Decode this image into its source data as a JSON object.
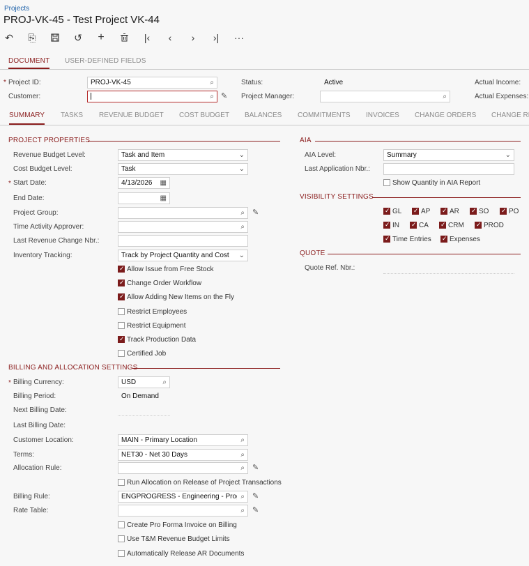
{
  "breadcrumb": "Projects",
  "title": "PROJ-VK-45 - Test Project VK-44",
  "toolbar": {
    "back": "↶",
    "save_close": "⎘",
    "save": "🖫",
    "undo": "↺",
    "add": "+",
    "delete": "🗑",
    "first": "|‹",
    "prev": "‹",
    "next": "›",
    "last": "›|",
    "more": "···"
  },
  "top_tabs": [
    "DOCUMENT",
    "USER-DEFINED FIELDS"
  ],
  "header": {
    "project_id_label": "Project ID:",
    "project_id": "PROJ-VK-45",
    "customer_label": "Customer:",
    "customer": "",
    "status_label": "Status:",
    "status": "Active",
    "project_manager_label": "Project Manager:",
    "project_manager": "",
    "actual_income_label": "Actual Income:",
    "actual_expenses_label": "Actual Expenses:"
  },
  "tabs": [
    "SUMMARY",
    "TASKS",
    "REVENUE BUDGET",
    "COST BUDGET",
    "BALANCES",
    "COMMITMENTS",
    "INVOICES",
    "CHANGE ORDERS",
    "CHANGE RE"
  ],
  "project_properties": {
    "title": "PROJECT PROPERTIES",
    "revenue_budget_level_label": "Revenue Budget Level:",
    "revenue_budget_level": "Task and Item",
    "cost_budget_level_label": "Cost Budget Level:",
    "cost_budget_level": "Task",
    "start_date_label": "Start Date:",
    "start_date": "4/13/2026",
    "end_date_label": "End Date:",
    "end_date": "",
    "project_group_label": "Project Group:",
    "time_activity_approver_label": "Time Activity Approver:",
    "last_revenue_change_label": "Last Revenue Change Nbr.:",
    "inventory_tracking_label": "Inventory Tracking:",
    "inventory_tracking": "Track by Project Quantity and Cost",
    "checkboxes": [
      {
        "label": "Allow Issue from Free Stock",
        "checked": true
      },
      {
        "label": "Change Order Workflow",
        "checked": true
      },
      {
        "label": "Allow Adding New Items on the Fly",
        "checked": true
      },
      {
        "label": "Restrict Employees",
        "checked": false
      },
      {
        "label": "Restrict Equipment",
        "checked": false
      },
      {
        "label": "Track Production Data",
        "checked": true
      },
      {
        "label": "Certified Job",
        "checked": false
      }
    ]
  },
  "billing": {
    "title": "BILLING AND ALLOCATION SETTINGS",
    "billing_currency_label": "Billing Currency:",
    "billing_currency": "USD",
    "billing_period_label": "Billing Period:",
    "billing_period": "On Demand",
    "next_billing_date_label": "Next Billing Date:",
    "last_billing_date_label": "Last Billing Date:",
    "customer_location_label": "Customer Location:",
    "customer_location": "MAIN - Primary Location",
    "terms_label": "Terms:",
    "terms": "NET30 - Net 30 Days",
    "allocation_rule_label": "Allocation Rule:",
    "run_allocation_label": "Run Allocation on Release of Project Transactions",
    "billing_rule_label": "Billing Rule:",
    "billing_rule": "ENGPROGRESS - Engineering - Progr",
    "rate_table_label": "Rate Table:",
    "pro_forma_label": "Create Pro Forma Invoice on Billing",
    "tm_limits_label": "Use T&M Revenue Budget Limits",
    "auto_release_label": "Automatically Release AR Documents"
  },
  "aia": {
    "title": "AIA",
    "aia_level_label": "AIA Level:",
    "aia_level": "Summary",
    "last_application_label": "Last Application Nbr.:",
    "show_quantity_label": "Show Quantity in AIA Report"
  },
  "visibility": {
    "title": "VISIBILITY SETTINGS",
    "items": [
      "GL",
      "AP",
      "AR",
      "SO",
      "PO",
      "IN",
      "CA",
      "CRM",
      "PROD",
      "Time Entries",
      "Expenses"
    ]
  },
  "quote": {
    "title": "QUOTE",
    "quote_ref_label": "Quote Ref. Nbr.:"
  },
  "icons": {
    "search": "⌕",
    "chevron": "⌄",
    "calendar": "▦",
    "pencil": "✎"
  }
}
